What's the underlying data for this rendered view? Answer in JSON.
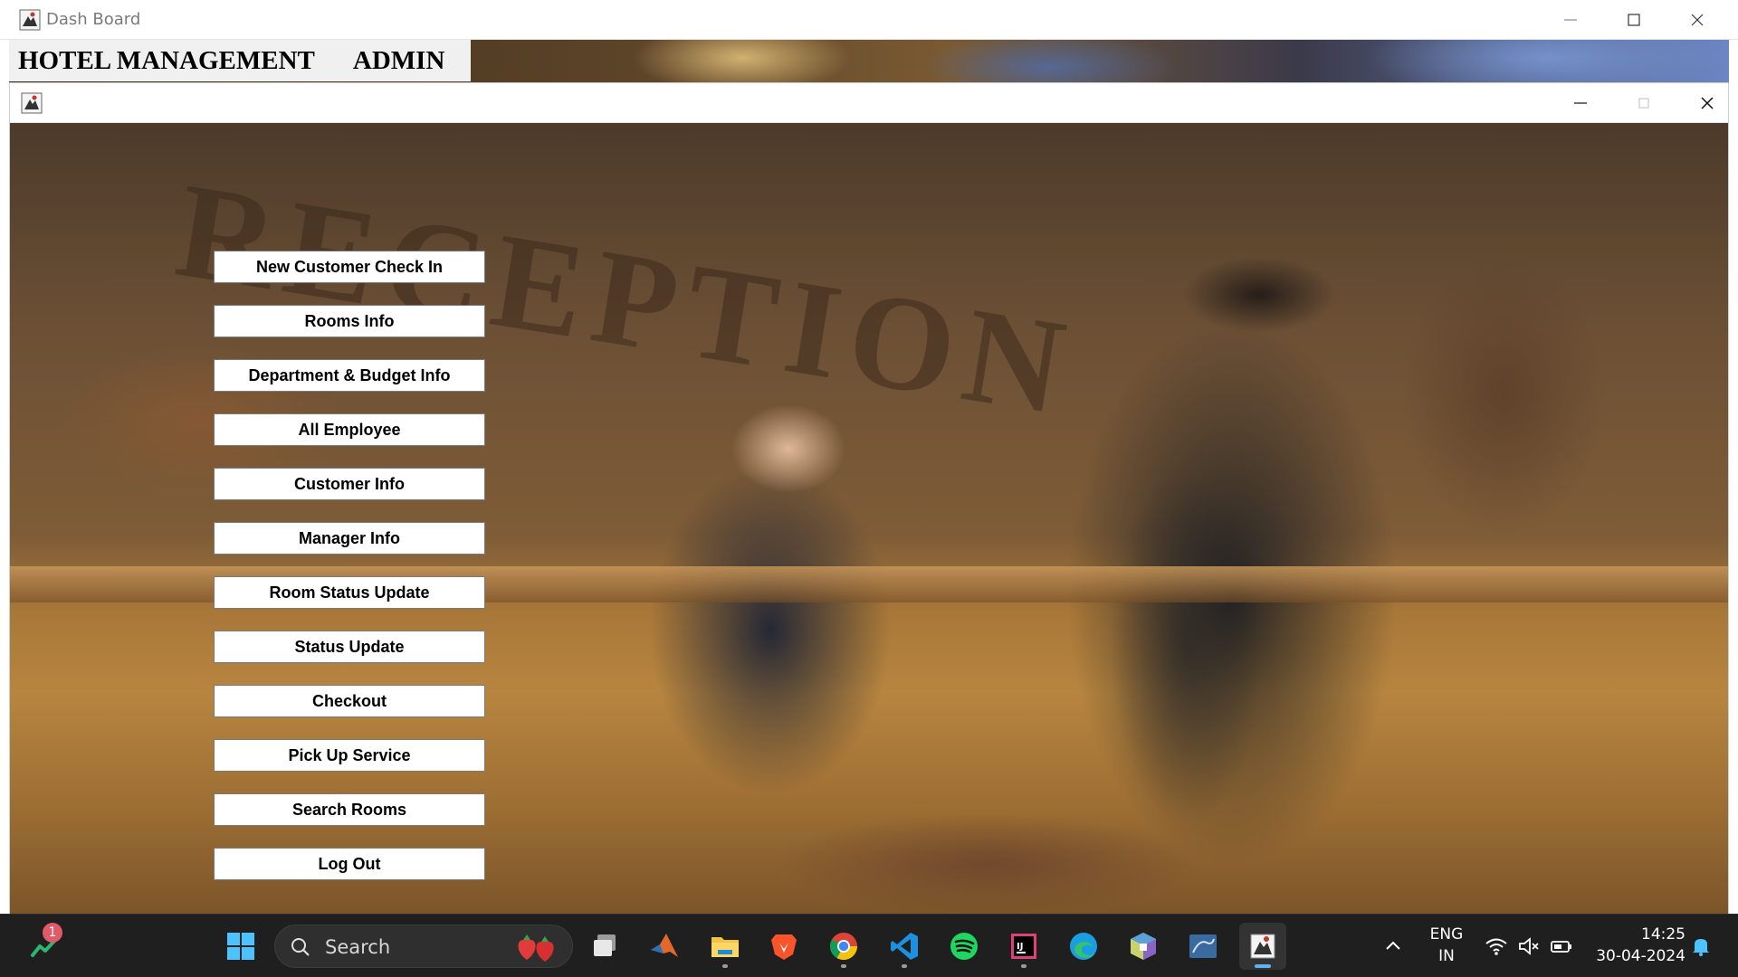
{
  "outer_window": {
    "title": "Dash Board",
    "menu": [
      "HOTEL MANAGEMENT",
      "ADMIN"
    ]
  },
  "inner_window": {
    "background_sign_text": "RECEPTION",
    "buttons": [
      "New Customer Check In",
      "Rooms Info",
      "Department & Budget Info",
      "All Employee",
      "Customer Info",
      "Manager Info",
      "Room Status Update",
      "Status Update",
      "Checkout",
      "Pick Up Service",
      "Search Rooms",
      "Log Out"
    ]
  },
  "taskbar": {
    "widget_badge": "1",
    "search_placeholder": "Search",
    "language_top": "ENG",
    "language_bottom": "IN",
    "time": "14:25",
    "date": "30-04-2024",
    "apps": [
      "start-icon",
      "task-view-icon",
      "matlab-icon",
      "file-explorer-icon",
      "brave-icon",
      "chrome-icon",
      "vscode-icon",
      "spotify-icon",
      "intellij-icon",
      "edge-icon",
      "box-app-icon",
      "mysql-workbench-icon",
      "java-app-icon"
    ]
  },
  "colors": {
    "taskbar_bg": "#1f1f1f",
    "button_bg": "#ffffff",
    "menubar_bg": "#f0f0f0",
    "active_indicator": "#5fb2f2"
  }
}
